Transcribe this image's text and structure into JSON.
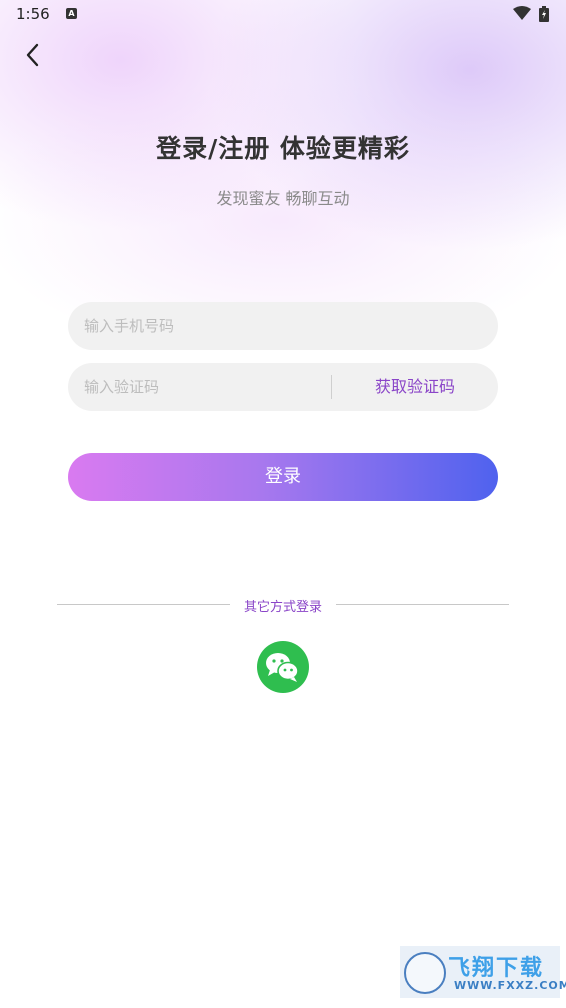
{
  "status_bar": {
    "time": "1:56",
    "icons": [
      "a-notification-icon",
      "wifi-icon",
      "battery-charging-icon"
    ]
  },
  "header": {
    "back_icon": "chevron-left-icon"
  },
  "hero": {
    "title": "登录/注册 体验更精彩",
    "subtitle": "发现蜜友 畅聊互动"
  },
  "form": {
    "phone_placeholder": "输入手机号码",
    "code_placeholder": "输入验证码",
    "get_code_label": "获取验证码",
    "login_label": "登录"
  },
  "other_login": {
    "label": "其它方式登录",
    "wechat_icon": "wechat-icon"
  },
  "watermark": {
    "text": "飞翔下载",
    "url": "WWW.FXXZ.COM"
  },
  "colors": {
    "accent_purple": "#8a45c8",
    "gradient_start": "#d97af0",
    "gradient_end": "#4f62ee",
    "wechat_green": "#2fbe4f",
    "input_bg": "#f1f1f1"
  }
}
